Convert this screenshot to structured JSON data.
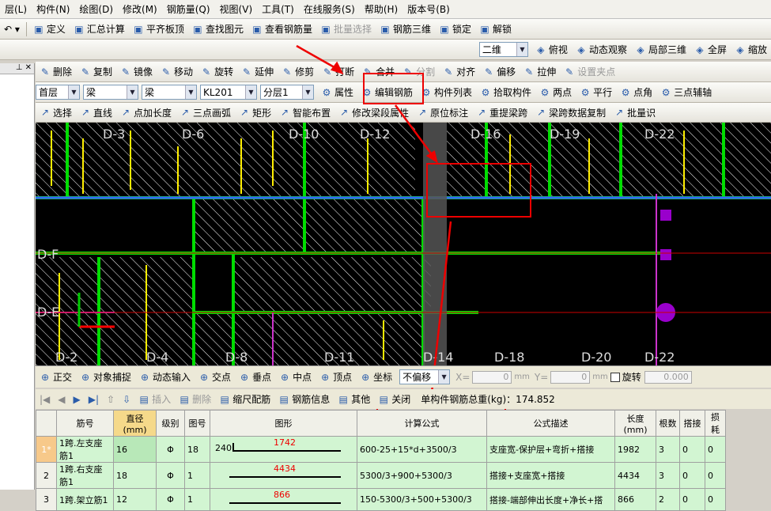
{
  "menu": [
    "层(L)",
    "构件(N)",
    "绘图(D)",
    "修改(M)",
    "钢筋量(Q)",
    "视图(V)",
    "工具(T)",
    "在线服务(S)",
    "帮助(H)",
    "版本号(B)"
  ],
  "toolbar1": [
    {
      "label": "定义",
      "icon": "define-icon"
    },
    {
      "label": "汇总计算",
      "icon": "sum-icon"
    },
    {
      "label": "平齐板顶",
      "icon": "align-top-icon"
    },
    {
      "label": "查找图元",
      "icon": "find-icon"
    },
    {
      "label": "查看钢筋量",
      "icon": "view-rebar-icon"
    },
    {
      "label": "批量选择",
      "icon": "batch-select-icon",
      "disabled": true
    },
    {
      "label": "钢筋三维",
      "icon": "rebar-3d-icon"
    },
    {
      "label": "锁定",
      "icon": "lock-icon"
    },
    {
      "label": "解锁",
      "icon": "unlock-icon"
    }
  ],
  "toolbar2": {
    "view_mode": "二维",
    "items": [
      "俯视",
      "动态观察",
      "局部三维",
      "全屏",
      "缩放"
    ]
  },
  "toolbar3": [
    "删除",
    "复制",
    "镜像",
    "移动",
    "旋转",
    "延伸",
    "修剪",
    "打断",
    "合并",
    "分割",
    "对齐",
    "偏移",
    "拉伸",
    "设置夹点"
  ],
  "toolbar4": {
    "floor": "首层",
    "cat": "梁",
    "sub": "梁",
    "name": "KL201",
    "layer": "分层1",
    "buttons": [
      "属性",
      "编辑钢筋",
      "构件列表",
      "拾取构件",
      "两点",
      "平行",
      "点角",
      "三点辅轴"
    ]
  },
  "toolbar5": [
    "选择",
    "直线",
    "点加长度",
    "三点画弧",
    "矩形",
    "智能布置",
    "修改梁段属性",
    "原位标注",
    "重提梁跨",
    "梁跨数据复制",
    "批量识"
  ],
  "canvas_labels": {
    "top": [
      "D-3",
      "D-6",
      "D-10",
      "D-12",
      "D-16",
      "D-19",
      "D-22"
    ],
    "bottom": [
      "D-2",
      "D-4",
      "D-8",
      "D-11",
      "D-14",
      "D-18",
      "D-20",
      "D-22"
    ],
    "left": [
      "D-E",
      "D-F"
    ]
  },
  "statusbar": {
    "items": [
      "正交",
      "对象捕捉",
      "动态输入",
      "交点",
      "垂点",
      "中点",
      "顶点",
      "坐标"
    ],
    "mode": "不偏移",
    "x_label": "X=",
    "x_val": "0",
    "y_label": "Y=",
    "y_val": "0",
    "unit": "mm",
    "rotate": "旋转",
    "angle": "0.000"
  },
  "rebarbar": {
    "items": [
      "插入",
      "删除",
      "缩尺配筋",
      "钢筋信息",
      "其他",
      "关闭"
    ],
    "total": "单构件钢筋总重(kg)：174.852"
  },
  "table": {
    "headers": [
      "筋号",
      "直径(mm)",
      "级别",
      "图号",
      "图形",
      "计算公式",
      "公式描述",
      "长度(mm)",
      "根数",
      "搭接",
      "损耗"
    ],
    "rows": [
      {
        "no": "1*",
        "name": "1跨.左支座筋1",
        "dia": "16",
        "grade": "Φ",
        "fig": "18",
        "left": "240",
        "shape_len": "1742",
        "formula": "600-25+15*d+3500/3",
        "desc": "支座宽-保护层+弯折+搭接",
        "length": "1982",
        "count": "3",
        "lap": "0",
        "loss": "0"
      },
      {
        "no": "2",
        "name": "1跨.右支座筋1",
        "dia": "18",
        "grade": "Φ",
        "fig": "1",
        "left": "",
        "shape_len": "4434",
        "formula": "5300/3+900+5300/3",
        "desc": "搭接+支座宽+搭接",
        "length": "4434",
        "count": "3",
        "lap": "0",
        "loss": "0"
      },
      {
        "no": "3",
        "name": "1跨.架立筋1",
        "dia": "12",
        "grade": "Φ",
        "fig": "1",
        "left": "",
        "shape_len": "866",
        "formula": "150-5300/3+500+5300/3",
        "desc": "搭接-端部伸出长度+净长+搭",
        "length": "866",
        "count": "2",
        "lap": "0",
        "loss": "0"
      }
    ]
  },
  "colors": {
    "accent": "#e00000",
    "canvas": "#000000",
    "beam": "#00cc00",
    "hatch": "#ffffff"
  }
}
